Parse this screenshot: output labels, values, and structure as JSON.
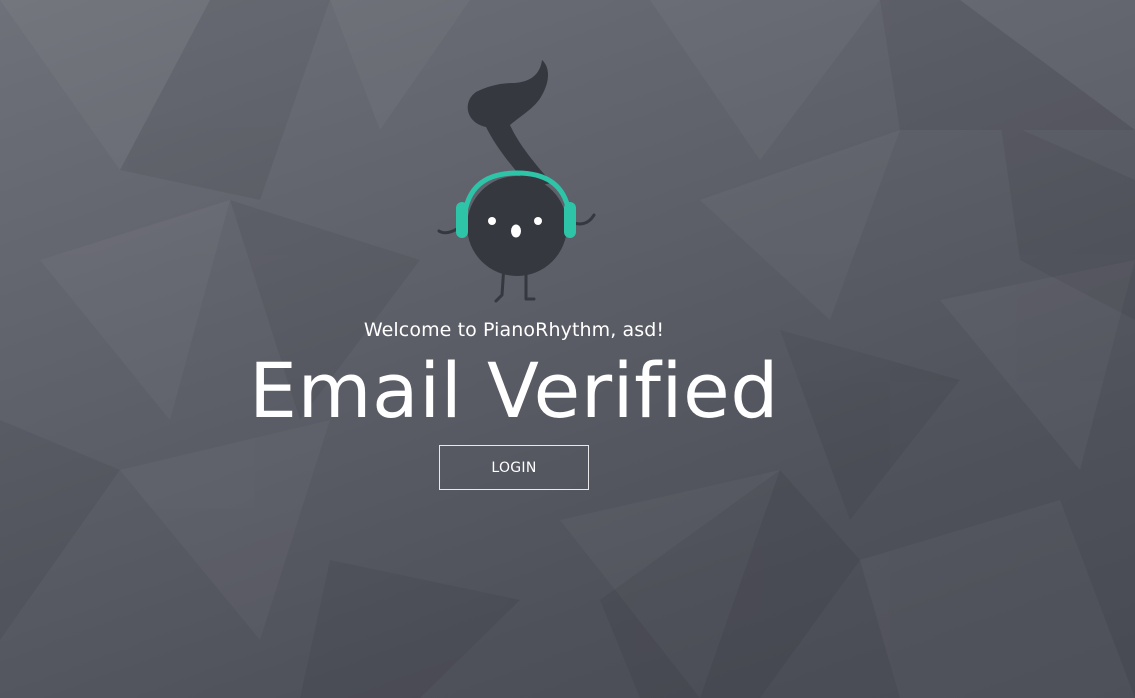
{
  "welcome_text": "Welcome to PianoRhythm, asd!",
  "title": "Email Verified",
  "login_button": "LOGIN",
  "mascot_icon": "music-note-with-headphones",
  "colors": {
    "background": "#5d5f69",
    "mascot_body": "#363840",
    "headphones": "#2ec4a8",
    "text": "#ffffff",
    "button_border": "#e9e9ec"
  }
}
